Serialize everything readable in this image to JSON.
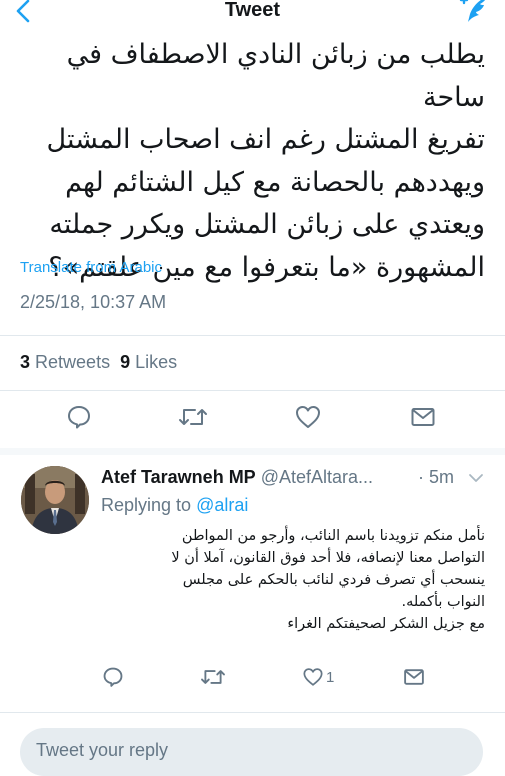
{
  "header": {
    "title": "Tweet",
    "back_icon": "chevron-left-icon",
    "compose_icon": "compose-tweet-icon",
    "accent": "#1da1f2"
  },
  "tweet": {
    "lines": [
      "يطلب من زبائن النادي الاصطفاف في ساحة",
      "تفريغ المشتل رغم انف اصحاب المشتل",
      "ويهددهم بالحصانة مع كيل الشتائم لهم",
      "ويعتدي على زبائن المشتل ويكرر جملته",
      "المشهورة «ما بتعرفوا مع مين علقتم»؟"
    ],
    "translate": "Translate from Arabic",
    "timestamp": "2/25/18, 10:37 AM",
    "retweet_count": "3",
    "retweet_label": "Retweets",
    "like_count": "9",
    "like_label": "Likes"
  },
  "reply": {
    "name": "Atef Tarawneh MP",
    "handle": "@AtefAltara...",
    "time": "· 5m",
    "replying_label": "Replying to",
    "replying_to": "@alrai",
    "lines": [
      "نأمل منكم تزويدنا باسم النائب، وأرجو من المواطن",
      "التواصل معنا لإنصافه، فلا أحد فوق القانون، آملا أن لا",
      "ينسحب أي تصرف فردي لنائب بالحكم على مجلس",
      "النواب بأكمله.",
      "مع جزيل الشكر لصحيفتكم الغراء"
    ],
    "like_count": "1"
  },
  "composer": {
    "placeholder": "Tweet your reply"
  }
}
